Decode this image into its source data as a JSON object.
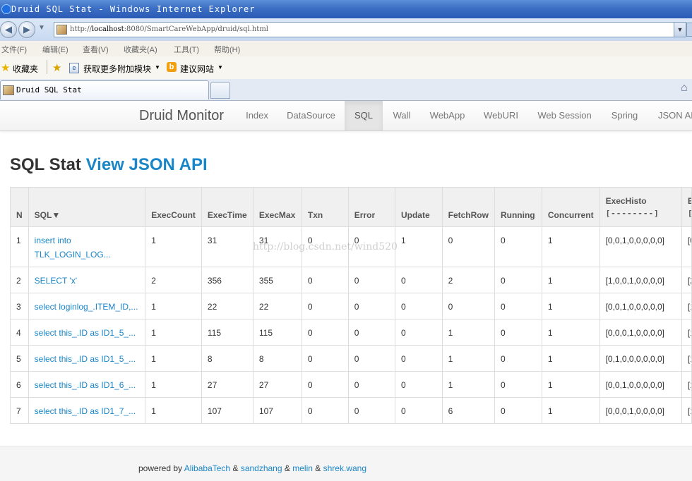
{
  "window": {
    "title": "Druid SQL Stat - Windows Internet Explorer",
    "url_prefix": "http://",
    "url_host": "localhost",
    "url_rest": ":8080/SmartCareWebApp/druid/sql.html"
  },
  "menu": [
    "文件(F)",
    "编辑(E)",
    "查看(V)",
    "收藏夹(A)",
    "工具(T)",
    "帮助(H)"
  ],
  "favorites": {
    "favorites_label": "收藏夹",
    "addons_label": "获取更多附加模块",
    "suggested_label": "建议网站"
  },
  "tab": {
    "title": "Druid SQL Stat"
  },
  "navbar": {
    "brand": "Druid Monitor",
    "items": [
      "Index",
      "DataSource",
      "SQL",
      "Wall",
      "WebApp",
      "WebURI",
      "Web Session",
      "Spring",
      "JSON API"
    ],
    "active": "SQL"
  },
  "heading": {
    "title": "SQL Stat",
    "link": "View JSON API"
  },
  "table": {
    "columns": [
      "N",
      "SQL▼",
      "ExecCount",
      "ExecTime",
      "ExecMax",
      "Txn",
      "Error",
      "Update",
      "FetchRow",
      "Running",
      "Concurrent",
      "ExecHisto",
      "E"
    ],
    "histo_sub": "[--------]",
    "rows": [
      {
        "n": "1",
        "sql1": "insert into",
        "sql2": "TLK_LOGIN_LOG...",
        "exec_count": "1",
        "exec_time": "31",
        "exec_max": "31",
        "txn": "0",
        "error": "0",
        "update": "1",
        "fetch_row": "0",
        "running": "0",
        "concurrent": "1",
        "histo": "[0,0,1,0,0,0,0,0]",
        "next": "[0"
      },
      {
        "n": "2",
        "sql1": "SELECT 'x'",
        "sql2": "",
        "exec_count": "2",
        "exec_time": "356",
        "exec_max": "355",
        "txn": "0",
        "error": "0",
        "update": "0",
        "fetch_row": "2",
        "running": "0",
        "concurrent": "1",
        "histo": "[1,0,0,1,0,0,0,0]",
        "next": "[2"
      },
      {
        "n": "3",
        "sql1": "select loginlog_.ITEM_ID,...",
        "sql2": "",
        "exec_count": "1",
        "exec_time": "22",
        "exec_max": "22",
        "txn": "0",
        "error": "0",
        "update": "0",
        "fetch_row": "0",
        "running": "0",
        "concurrent": "1",
        "histo": "[0,0,1,0,0,0,0,0]",
        "next": "[1"
      },
      {
        "n": "4",
        "sql1": "select this_.ID as ID1_5_...",
        "sql2": "",
        "exec_count": "1",
        "exec_time": "115",
        "exec_max": "115",
        "txn": "0",
        "error": "0",
        "update": "0",
        "fetch_row": "1",
        "running": "0",
        "concurrent": "1",
        "histo": "[0,0,0,1,0,0,0,0]",
        "next": "[1"
      },
      {
        "n": "5",
        "sql1": "select this_.ID as ID1_5_...",
        "sql2": "",
        "exec_count": "1",
        "exec_time": "8",
        "exec_max": "8",
        "txn": "0",
        "error": "0",
        "update": "0",
        "fetch_row": "1",
        "running": "0",
        "concurrent": "1",
        "histo": "[0,1,0,0,0,0,0,0]",
        "next": "[1"
      },
      {
        "n": "6",
        "sql1": "select this_.ID as ID1_6_...",
        "sql2": "",
        "exec_count": "1",
        "exec_time": "27",
        "exec_max": "27",
        "txn": "0",
        "error": "0",
        "update": "0",
        "fetch_row": "1",
        "running": "0",
        "concurrent": "1",
        "histo": "[0,0,1,0,0,0,0,0]",
        "next": "[1"
      },
      {
        "n": "7",
        "sql1": "select this_.ID as ID1_7_...",
        "sql2": "",
        "exec_count": "1",
        "exec_time": "107",
        "exec_max": "107",
        "txn": "0",
        "error": "0",
        "update": "0",
        "fetch_row": "6",
        "running": "0",
        "concurrent": "1",
        "histo": "[0,0,0,1,0,0,0,0]",
        "next": "[1"
      }
    ]
  },
  "watermark": "http://blog.csdn.net/wind520",
  "footer": {
    "prefix": "powered by",
    "names": [
      "AlibabaTech",
      "sandzhang",
      "melin",
      "shrek.wang"
    ],
    "sep": "&"
  },
  "colors": {
    "link": "#1a86c8",
    "titlebar": "#2a5ab5",
    "nav_active": "#e5e5e5"
  },
  "icons": [
    "ie-logo-icon",
    "back-icon",
    "forward-icon",
    "page-icon",
    "favorites-star-icon",
    "add-favorite-icon",
    "addons-icon",
    "suggested-sites-icon",
    "home-icon"
  ]
}
